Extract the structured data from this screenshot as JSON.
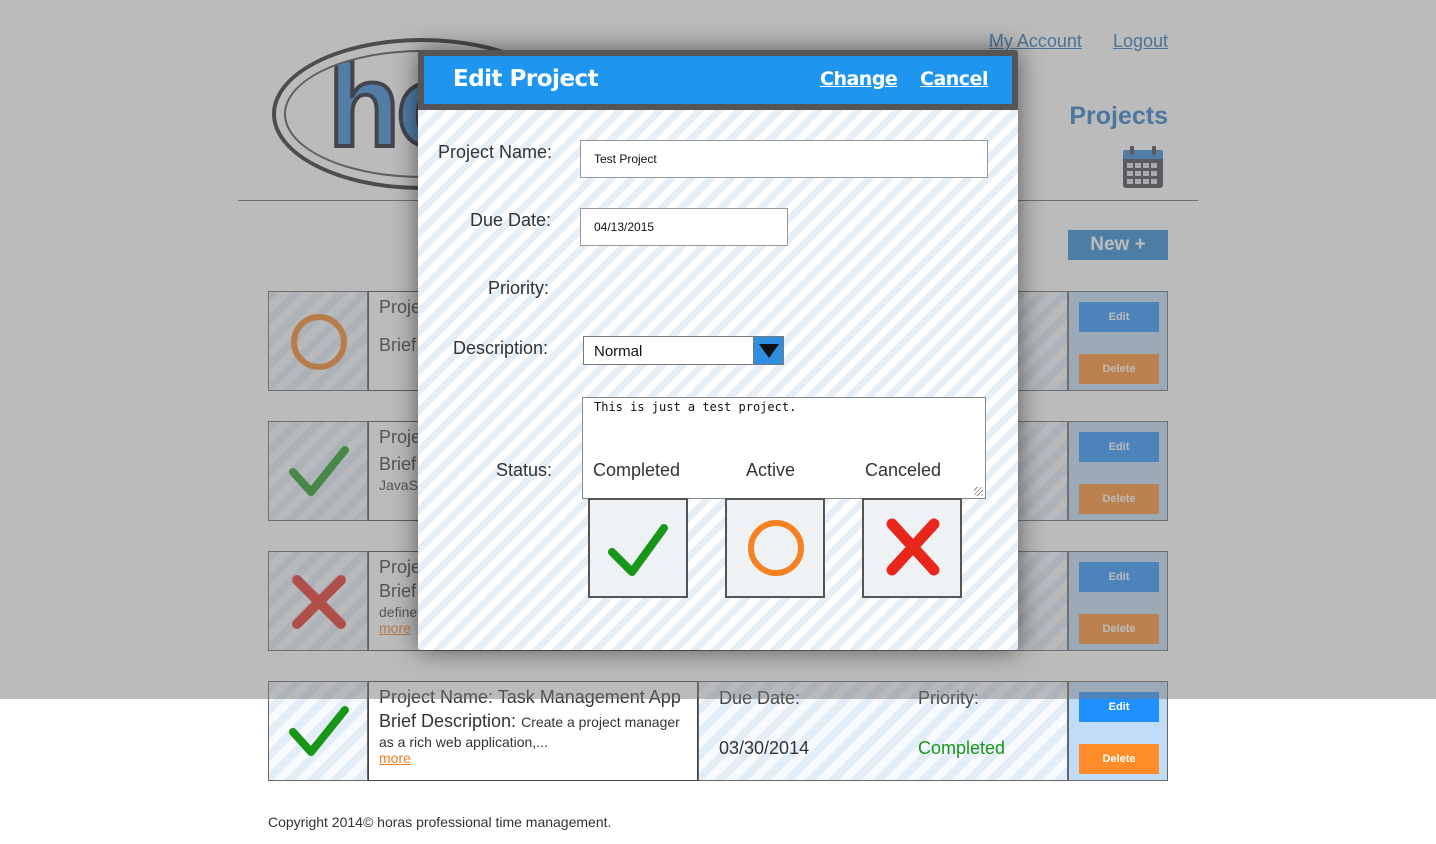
{
  "header": {
    "logo_text": "ho",
    "my_account": "My Account",
    "logout": "Logout",
    "page_title": "Projects",
    "new_button": "New +"
  },
  "projects": [
    {
      "status": "active",
      "name": "Proje",
      "desc_label": "Brief",
      "desc": "",
      "more": ""
    },
    {
      "status": "completed",
      "name": "Proje",
      "desc_label": "Brief",
      "desc": "JavaS",
      "more": ""
    },
    {
      "status": "canceled",
      "name": "Proje",
      "desc_label": "Brief",
      "desc": "define",
      "more": "more"
    },
    {
      "status": "completed",
      "name": "Project Name: Task Management App",
      "desc_label": "Brief Description:",
      "desc": "Create a project manager",
      "desc2": "as a rich web application,...",
      "more": "more",
      "due_label": "Due Date:",
      "due": "03/30/2014",
      "priority_label": "Priority:",
      "priority": "Completed"
    }
  ],
  "row_actions": {
    "edit": "Edit",
    "delete": "Delete"
  },
  "footer": "Copyright 2014© horas professional time management.",
  "modal": {
    "title": "Edit Project",
    "change": "Change",
    "cancel": "Cancel",
    "project_name_label": "Project Name:",
    "project_name_value": "Test Project",
    "due_date_label": "Due Date:",
    "due_date_value": "04/13/2015",
    "priority_label": "Priority:",
    "priority_value": "Normal",
    "description_label": "Description:",
    "description_value": "This is just a test project.",
    "status_label": "Status:",
    "status_options": [
      "Completed",
      "Active",
      "Canceled"
    ]
  },
  "colors": {
    "accent": "#1e96f0",
    "completed": "#179617",
    "active": "#f5821f",
    "canceled": "#e8261b",
    "delete": "#ff8c28"
  },
  "icons": {
    "completed": "check-icon",
    "active": "circle-icon",
    "canceled": "x-icon",
    "calendar": "calendar-icon"
  }
}
